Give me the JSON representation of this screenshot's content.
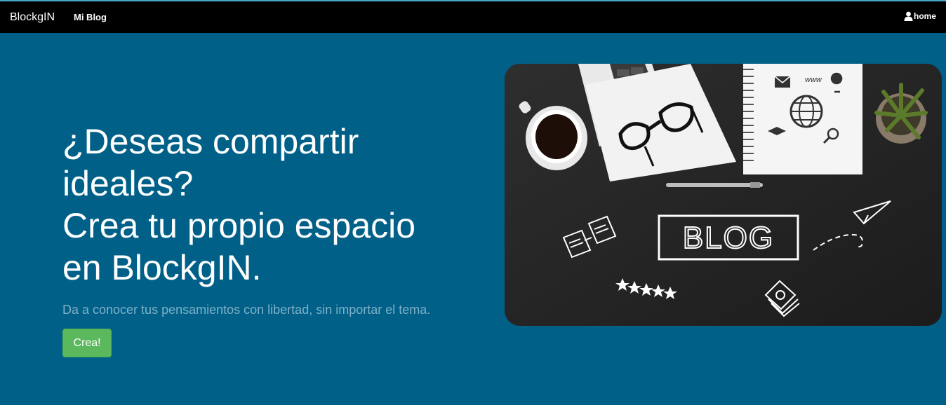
{
  "nav": {
    "brand": "BlockgIN",
    "blog_link": "Mi Blog",
    "home_link": "home",
    "home_icon": "user-icon"
  },
  "hero": {
    "title_line1": "¿Deseas compartir",
    "title_line2": "ideales?",
    "title_line3": "Crea tu propio espacio",
    "title_line4": "en BlockgIN.",
    "subtitle": "Da a conocer tus pensamientos con libertad, sin importar el tema.",
    "button_label": "Crea!"
  },
  "image": {
    "sign_text": "BLOG",
    "web_text": "www"
  },
  "colors": {
    "background": "#006088",
    "navbar": "#000000",
    "button": "#5cb85c",
    "subtitle": "#7fb0c8"
  }
}
